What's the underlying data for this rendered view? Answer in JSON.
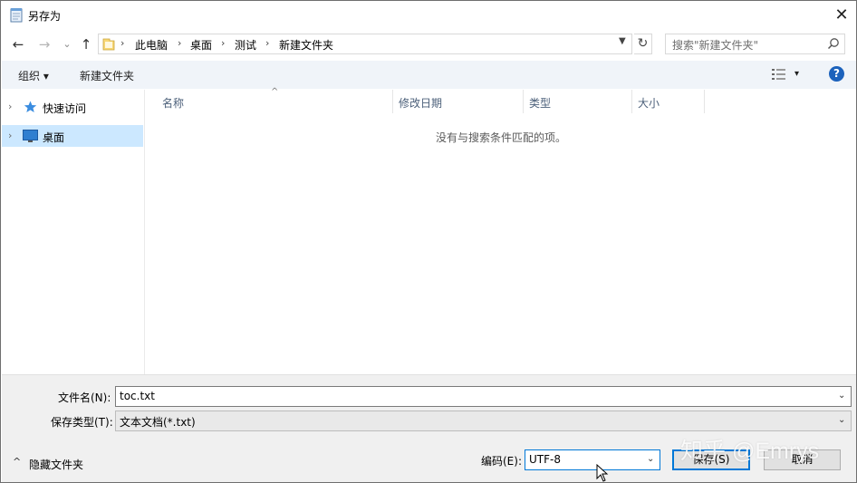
{
  "window": {
    "title": "另存为",
    "close_glyph": "✕"
  },
  "nav": {
    "back_glyph": "←",
    "forward_glyph": "→",
    "recent_glyph": "⌄",
    "up_glyph": "↑",
    "breadcrumbs": [
      "此电脑",
      "桌面",
      "测试",
      "新建文件夹"
    ],
    "sep_glyph": "›",
    "refresh_glyph": "↻",
    "search_placeholder": "搜索\"新建文件夹\""
  },
  "toolbar": {
    "organize_label": "组织 ▾",
    "new_folder_label": "新建文件夹",
    "view_dd_glyph": "▾",
    "help_glyph": "?"
  },
  "sidebar": {
    "items": [
      {
        "label": "快速访问",
        "icon": "star-icon"
      },
      {
        "label": "桌面",
        "icon": "desktop-icon"
      }
    ]
  },
  "columns": [
    "名称",
    "修改日期",
    "类型",
    "大小"
  ],
  "sort_glyph": "^",
  "empty_message": "没有与搜索条件匹配的项。",
  "form": {
    "filename_label": "文件名(N):",
    "filename_value": "toc.txt",
    "filetype_label": "保存类型(T):",
    "filetype_value": "文本文档(*.txt)",
    "hide_folders_label": "隐藏文件夹",
    "encoding_label": "编码(E):",
    "encoding_value": "UTF-8",
    "save_label": "保存(S)",
    "cancel_label": "取消"
  },
  "watermark": "知乎 @Emrys",
  "colors": {
    "accent": "#0078d7",
    "selection": "#cce8ff",
    "toolbar_bg": "#f0f4f9",
    "bottom_bg": "#f0f0f0"
  }
}
